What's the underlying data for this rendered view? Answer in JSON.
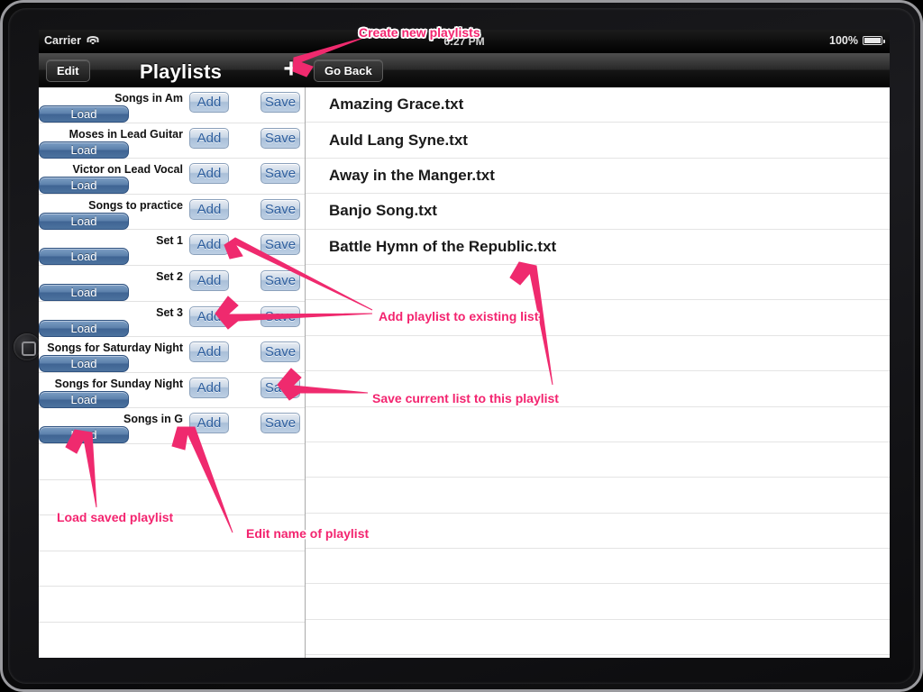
{
  "device": {
    "name": "ipad-frame"
  },
  "status_bar": {
    "carrier": "Carrier",
    "wifi_icon": "wifi-icon",
    "time": "6:27 PM",
    "battery_percent": "100%",
    "battery_icon": "battery-icon"
  },
  "nav_bar": {
    "edit_label": "Edit",
    "title": "Playlists",
    "add_icon": "plus-icon",
    "go_back_label": "Go Back"
  },
  "playlists": {
    "load_label": "Load",
    "add_label": "Add",
    "save_label": "Save",
    "items": [
      {
        "name": "Songs in Am"
      },
      {
        "name": "Moses in Lead Guitar"
      },
      {
        "name": "Victor on Lead Vocal"
      },
      {
        "name": "Songs to practice"
      },
      {
        "name": "Set 1"
      },
      {
        "name": "Set 2"
      },
      {
        "name": "Set 3"
      },
      {
        "name": "Songs for Saturday Night"
      },
      {
        "name": "Songs for Sunday Night"
      },
      {
        "name": "Songs in G"
      }
    ],
    "empty_row_count": 6
  },
  "songs": {
    "items": [
      "Amazing Grace.txt",
      "Auld Lang Syne.txt",
      "Away in the Manger.txt",
      "Banjo Song.txt",
      "Battle Hymn of the Republic.txt"
    ],
    "empty_row_count": 11
  },
  "annotations": {
    "accent_color": "#f3246f",
    "items": [
      {
        "text": "Create new playlists"
      },
      {
        "text": "Add playlist to existing list"
      },
      {
        "text": "Save current list to this playlist"
      },
      {
        "text": "Load saved playlist"
      },
      {
        "text": "Edit name of playlist"
      }
    ]
  }
}
